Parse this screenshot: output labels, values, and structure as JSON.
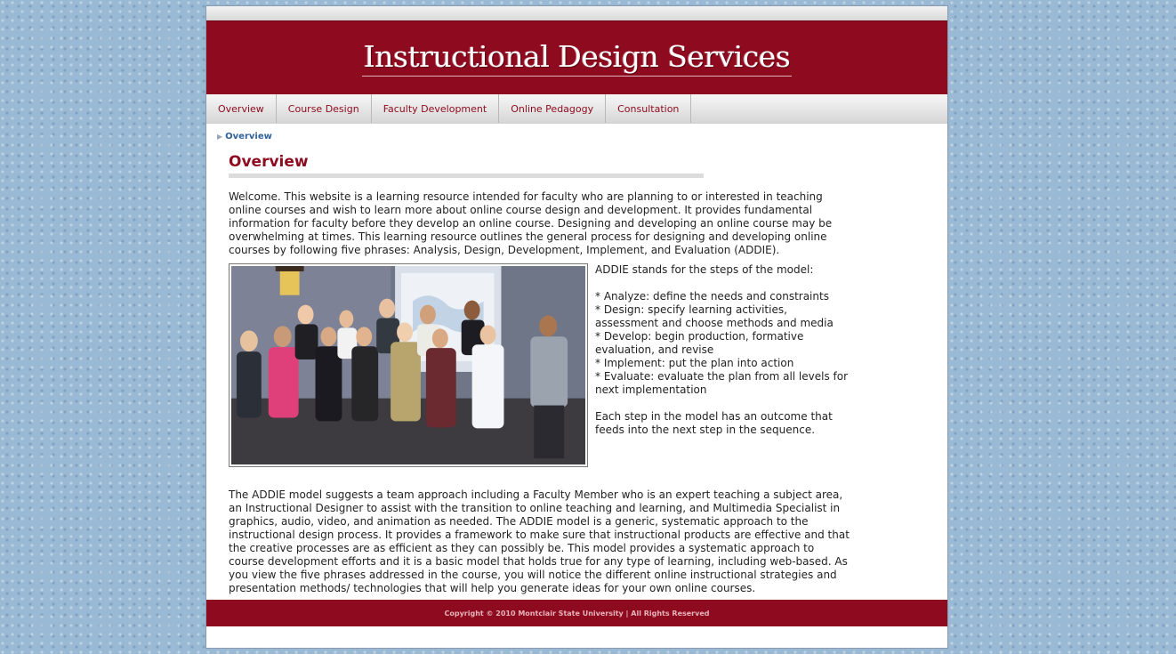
{
  "header": {
    "title": "Instructional Design Services"
  },
  "nav": {
    "items": [
      {
        "label": "Overview"
      },
      {
        "label": "Course Design"
      },
      {
        "label": "Faculty Development"
      },
      {
        "label": "Online Pedagogy"
      },
      {
        "label": "Consultation"
      }
    ]
  },
  "breadcrumb": {
    "current": "Overview"
  },
  "main": {
    "title": "Overview",
    "intro": "Welcome. This website is a learning resource intended for faculty who are planning to or interested in teaching online courses and wish to learn more about online course design and development. It provides fundamental information for faculty before they develop an online course. Designing and developing an online course may be overwhelming at times. This learning resource outlines the general process for designing and developing online courses by following five phrases: Analysis, Design, Development, Implement, and Evaluation (ADDIE).",
    "addie_intro": "ADDIE stands for the steps of the model:",
    "addie_steps": [
      "* Analyze: define the needs and constraints",
      "* Design: specify learning activities, assessment and choose methods and media",
      "* Develop: begin production, formative evaluation, and revise",
      "* Implement: put the plan into action",
      "* Evaluate: evaluate the plan from all levels for next implementation"
    ],
    "addie_outro": "Each step in the model has an outcome that feeds into the next step in the sequence.",
    "team_paragraph": "The ADDIE model suggests a team approach including a Faculty Member who is an expert teaching a subject area, an Instructional Designer to assist with the transition to online teaching and learning, and Multimedia Specialist in graphics, audio, video, and animation as needed. The ADDIE model is a generic, systematic approach to the instructional design process. It provides a framework to make sure that instructional products are effective and that the creative processes are as efficient as they can possibly be. This model provides a systematic approach to course development efforts and it is a basic model that holds true for any type of learning, including web-based. As you view the five phrases addressed in the course, you will notice the different online instructional strategies and presentation methods/ technologies that will help you generate ideas for your own online courses."
  },
  "footer": {
    "text": "Copyright © 2010 Montclair State University  |  All Rights Reserved"
  },
  "colors": {
    "brand": "#8e0a1e",
    "link": "#2f6199",
    "background": "#9ab9d4"
  }
}
